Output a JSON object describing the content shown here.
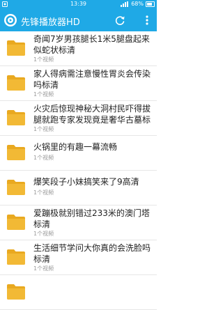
{
  "status_bar": {
    "time": "13:39",
    "battery": "68%"
  },
  "app_bar": {
    "title": "先锋播放器HD"
  },
  "colors": {
    "accent": "#1fa9e6",
    "folder": "#f2b935",
    "folder_tab": "#e9a920"
  },
  "items": [
    {
      "title": "奇闻7岁男孩腿长1米5腿盘起来似蛇状标清",
      "count": "1个视频"
    },
    {
      "title": "家人得病需注意慢性胃炎会传染吗标清",
      "count": "1个视频"
    },
    {
      "title": "火灾后惊现神秘大洞村民吓得拔腿就跑专家发现竟是奢华古墓标清",
      "count": "1个视频"
    },
    {
      "title": "火锅里的有趣一幕流畅",
      "count": "1个视频"
    },
    {
      "title": "爆笑段子小妹搞笑来了9高清",
      "count": "1个视频"
    },
    {
      "title": "爱蹦极就别错过233米的澳门塔标清",
      "count": "1个视频"
    },
    {
      "title": "生活细节学问大你真的会洗脸吗标清",
      "count": "1个视频"
    },
    {
      "title": "",
      "count": ""
    }
  ]
}
